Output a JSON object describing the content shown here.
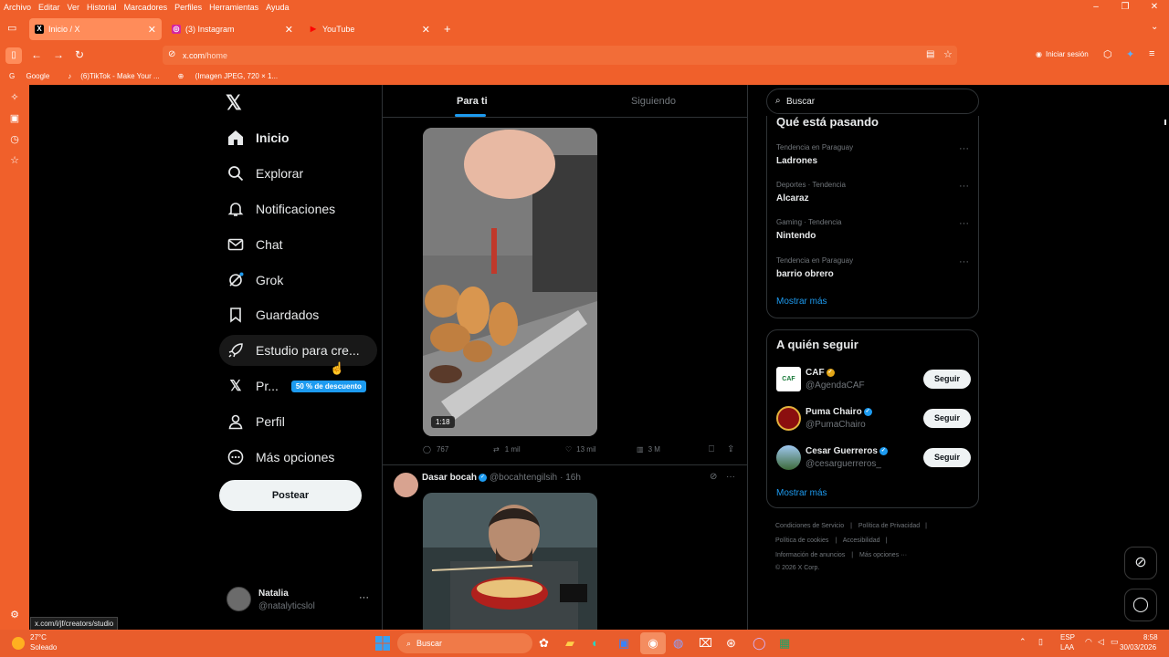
{
  "menubar": {
    "items": [
      "Archivo",
      "Editar",
      "Ver",
      "Historial",
      "Marcadores",
      "Perfiles",
      "Herramientas",
      "Ayuda"
    ]
  },
  "tabs": [
    {
      "label": "Inicio / X",
      "favicon": "X"
    },
    {
      "label": "(3) Instagram",
      "favicon": "◎"
    },
    {
      "label": "YouTube",
      "favicon": "▶"
    }
  ],
  "urlbar": {
    "host": "x.com",
    "path": "/home"
  },
  "nav_right": {
    "signin": "Iniciar sesión"
  },
  "bookmarks": [
    "Google",
    "(6)TikTok - Make Your ...",
    "(Imagen JPEG, 720 × 1..."
  ],
  "xnav": {
    "items": [
      "Inicio",
      "Explorar",
      "Notificaciones",
      "Chat",
      "Grok",
      "Guardados",
      "Estudio para cre...",
      "Pr...",
      "Perfil",
      "Más opciones"
    ],
    "premium_badge": "50 % de descuento",
    "post_button": "Postear",
    "user": {
      "name": "Natalia",
      "handle": "@natalyticslol"
    }
  },
  "feed": {
    "tabs": [
      "Para ti",
      "Siguiendo"
    ],
    "video_duration": "1:18",
    "post1_stats": {
      "replies": "767",
      "reposts": "1 mil",
      "likes": "13 mil",
      "views": "3 M"
    },
    "post2": {
      "author": "Dasar bocah",
      "handle": "@bocahtengilsih",
      "time": "· 16h"
    }
  },
  "search": {
    "placeholder": "Buscar"
  },
  "trends": {
    "title": "Qué está pasando",
    "items": [
      {
        "cat": "Tendencia en Paraguay",
        "name": "Ladrones"
      },
      {
        "cat": "Deportes · Tendencia",
        "name": "Alcaraz"
      },
      {
        "cat": "Gaming · Tendencia",
        "name": "Nintendo"
      },
      {
        "cat": "Tendencia en Paraguay",
        "name": "barrio obrero"
      }
    ],
    "more": "Mostrar más"
  },
  "whotofollow": {
    "title": "A quién seguir",
    "items": [
      {
        "name": "CAF",
        "handle": "@AgendaCAF",
        "button": "Seguir"
      },
      {
        "name": "Puma Chairo",
        "handle": "@PumaChairo",
        "button": "Seguir"
      },
      {
        "name": "Cesar Guerreros",
        "handle": "@cesarguerreros_",
        "button": "Seguir"
      }
    ],
    "more": "Mostrar más"
  },
  "footer": {
    "l1a": "Condiciones de Servicio",
    "l1b": "Política de Privacidad",
    "l2a": "Política de cookies",
    "l2b": "Accesibilidad",
    "l3a": "Información de anuncios",
    "l3b": "Más opciones ···",
    "copyright": "© 2026 X Corp."
  },
  "statusurl": "x.com/i/jf/creators/studio",
  "taskbar": {
    "weather_temp": "27°C",
    "weather_desc": "Soleado",
    "search": "Buscar",
    "lang1": "ESP",
    "lang2": "LAA",
    "time": "8:58",
    "date": "30/03/2026"
  },
  "colors": {
    "firefox_orange": "#f0602b",
    "x_blue": "#1d9bf0",
    "bg": "#000000"
  }
}
